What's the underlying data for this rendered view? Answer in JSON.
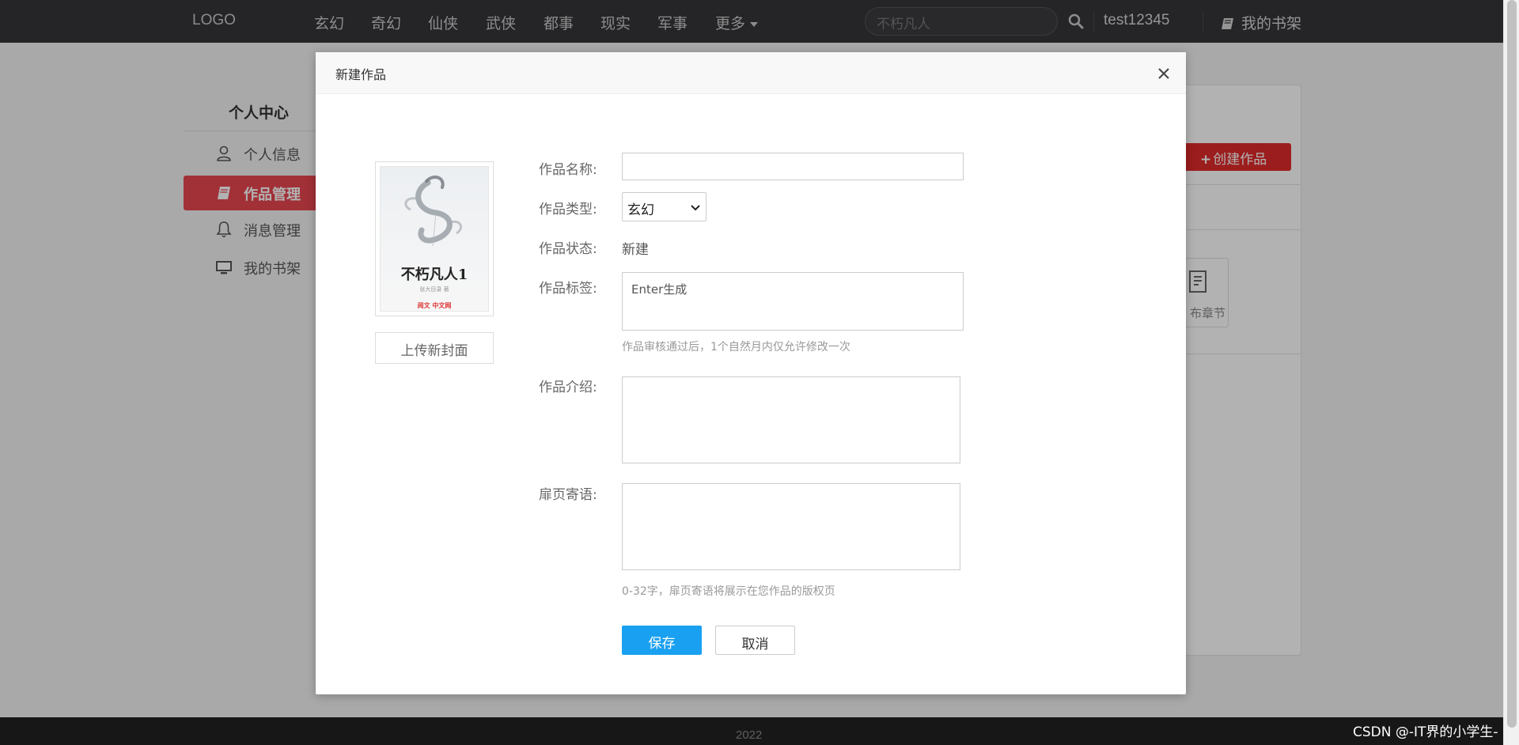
{
  "nav": {
    "logo": "LOGO",
    "categories": [
      "玄幻",
      "奇幻",
      "仙侠",
      "武侠",
      "都事",
      "现实",
      "军事",
      "更多"
    ],
    "search_placeholder": "不朽凡人",
    "username": "test12345",
    "bookshelf": "我的书架"
  },
  "sidebar": {
    "title": "个人中心",
    "items": [
      {
        "label": "个人信息",
        "icon": "user-icon"
      },
      {
        "label": "作品管理",
        "icon": "book-icon",
        "active": true
      },
      {
        "label": "消息管理",
        "icon": "bell-icon"
      },
      {
        "label": "我的书架",
        "icon": "monitor-icon"
      }
    ]
  },
  "content": {
    "create_label": "创建作品",
    "publish_chapter": "布章节"
  },
  "footer": {
    "year": "2022"
  },
  "watermark": "CSDN @-IT界的小学生-",
  "modal": {
    "title": "新建作品",
    "cover": {
      "title": "不朽凡人1",
      "author": "张大目录 著",
      "publisher": "阅文 中文网"
    },
    "upload_label": "上传新封面",
    "fields": {
      "name_label": "作品名称:",
      "name_value": "",
      "type_label": "作品类型:",
      "type_value": "玄幻",
      "status_label": "作品状态:",
      "status_value": "新建",
      "tags_label": "作品标签:",
      "tags_placeholder": "Enter生成",
      "tags_hint": "作品审核通过后，1个自然月内仅允许修改一次",
      "intro_label": "作品介绍:",
      "dedication_label": "扉页寄语:",
      "dedication_hint": "0-32字，扉页寄语将展示在您作品的版权页"
    },
    "save_label": "保存",
    "cancel_label": "取消"
  },
  "colors": {
    "nav_bg": "#36363a",
    "active_red": "#e7464f",
    "create_red": "#e02a2a",
    "save_blue": "#1aa0f0"
  }
}
